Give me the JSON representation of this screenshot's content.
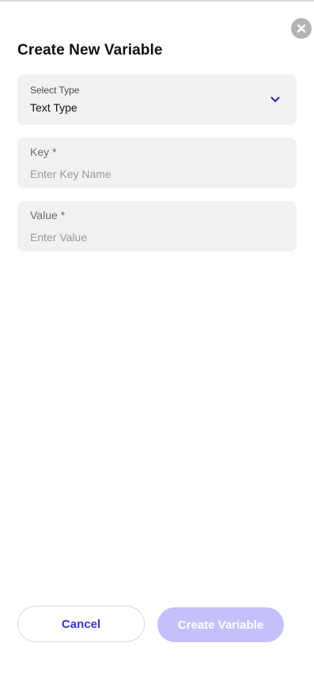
{
  "dialog": {
    "title": "Create New Variable"
  },
  "type_select": {
    "label": "Select Type",
    "value": "Text Type",
    "icon": "chevron-down-icon"
  },
  "key_field": {
    "label": "Key *",
    "value": "",
    "placeholder": "Enter Key Name"
  },
  "value_field": {
    "label": "Value *",
    "value": "",
    "placeholder": "Enter Value"
  },
  "actions": {
    "cancel_label": "Cancel",
    "create_label": "Create Variable"
  },
  "icons": {
    "close": "close-icon"
  },
  "colors": {
    "accent": "#3a35c9",
    "chevron": "#2a1fa8",
    "create_disabled_bg": "#c3c0fb",
    "field_bg": "#f2f1ef",
    "close_bg": "#b3b3b3"
  }
}
